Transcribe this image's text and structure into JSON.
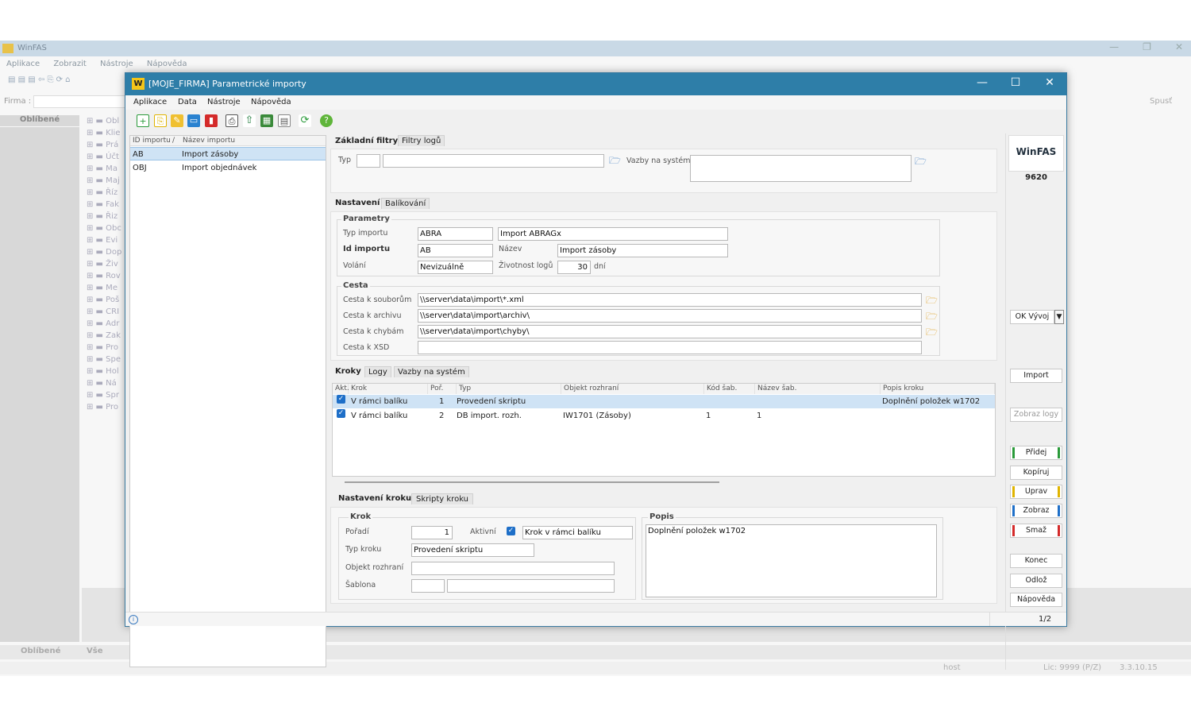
{
  "bg": {
    "title": "WinFAS",
    "menu": [
      "Aplikace",
      "Zobrazit",
      "Nástroje",
      "Nápověda"
    ],
    "firma_label": "Firma :",
    "tab_favorites": "Oblíbené",
    "bottom_tab1": "Oblíbené",
    "bottom_tab2": "Vše",
    "spust": "Spusť",
    "status_user": "host",
    "status_lic": "Lic: 9999 (P/Z)",
    "status_version": "3.3.10.15",
    "tree": [
      "Obl",
      "Klie",
      "Prá",
      "Účt",
      "Ma",
      "Maj",
      "Říz",
      "Fak",
      "Řiz",
      "Obc",
      "Evi",
      "Dop",
      "Živ",
      "Rov",
      "Me",
      "Poš",
      "CRI",
      "Adr",
      "Zak",
      "Pro",
      "Spe",
      "Hol",
      "Ná",
      "Spr",
      "Pro"
    ]
  },
  "dialog": {
    "title": "[MOJE_FIRMA] Parametrické importy",
    "menu": [
      "Aplikace",
      "Data",
      "Nástroje",
      "Nápověda"
    ],
    "toolbar_icons": [
      "add-icon",
      "copy-icon",
      "edit-icon",
      "view-icon",
      "delete-icon",
      "print-icon",
      "export-icon",
      "grid-icon",
      "report-icon",
      "refresh-icon",
      "help-icon"
    ]
  },
  "list": {
    "col_id": "ID importu",
    "col_sort": "/",
    "col_name": "Název importu",
    "rows": [
      {
        "id": "AB",
        "name": "Import zásoby"
      },
      {
        "id": "OBJ",
        "name": "Import objednávek"
      }
    ]
  },
  "filters": {
    "tab_basic": "Základní filtry",
    "tab_logs": "Filtry logů",
    "typ_label": "Typ",
    "vazby_label": "Vazby na systém"
  },
  "settings": {
    "tab_settings": "Nastavení",
    "tab_packaging": "Balíkování",
    "params_legend": "Parametry",
    "typ_importu_label": "Typ importu",
    "typ_importu_code": "ABRA",
    "typ_importu_name": "Import ABRAGx",
    "id_importu_label": "Id importu",
    "id_importu_value": "AB",
    "nazev_label": "Název",
    "nazev_value": "Import zásoby",
    "volani_label": "Volání",
    "volani_value": "Nevizuálně",
    "zivotnost_label": "Životnost logů",
    "zivotnost_value": "30",
    "zivotnost_unit": "dní",
    "cesta_legend": "Cesta",
    "cesta_soubory_label": "Cesta k souborům",
    "cesta_soubory_value": "\\\\server\\data\\import\\*.xml",
    "cesta_archiv_label": "Cesta k archivu",
    "cesta_archiv_value": "\\\\server\\data\\import\\archiv\\",
    "cesta_chyby_label": "Cesta k chybám",
    "cesta_chyby_value": "\\\\server\\data\\import\\chyby\\",
    "cesta_xsd_label": "Cesta k XSD",
    "cesta_xsd_value": ""
  },
  "steps": {
    "tab_kroky": "Kroky",
    "tab_logy": "Logy",
    "tab_vazby": "Vazby na systém",
    "columns": [
      "Akt.",
      "Krok",
      "Poř.",
      "Typ",
      "Objekt rozhraní",
      "Kód šab.",
      "Název šab.",
      "Popis kroku"
    ],
    "rows": [
      {
        "krok": "V rámci balíku",
        "por": "1",
        "typ": "Provedení skriptu",
        "objekt": "",
        "kod": "",
        "nazev": "",
        "popis": "Doplnění položek w1702"
      },
      {
        "krok": "V rámci balíku",
        "por": "2",
        "typ": "DB import. rozh.",
        "objekt": "IW1701 (Zásoby)",
        "kod": "1",
        "nazev": "1",
        "popis": ""
      }
    ]
  },
  "step_detail": {
    "tab_settings": "Nastavení kroku",
    "tab_scripts": "Skripty kroku",
    "krok_legend": "Krok",
    "poradi_label": "Pořadí",
    "poradi_value": "1",
    "aktivni_label": "Aktivní",
    "krok_value": "Krok v rámci balíku",
    "typ_kroku_label": "Typ kroku",
    "typ_kroku_value": "Provedení skriptu",
    "objekt_label": "Objekt rozhraní",
    "objekt_value": "",
    "sablona_label": "Šablona",
    "popis_legend": "Popis",
    "popis_value": "Doplnění položek w1702"
  },
  "side": {
    "brand": "WinFAS",
    "number": "9620",
    "ok_vyvoj": "OK Vývoj",
    "import": "Import",
    "zobraz_logy": "Zobraz logy",
    "pridej": "Přidej",
    "kopiruj": "Kopíruj",
    "uprav": "Uprav",
    "zobraz": "Zobraz",
    "smaz": "Smaž",
    "konec": "Konec",
    "odloz": "Odlož",
    "napoveda": "Nápověda"
  },
  "statusbar": {
    "page": "1/2"
  },
  "colors": {
    "titlebar": "#2e7ea8",
    "selection": "#cfe3f5",
    "add": "#2a9a3a",
    "edit": "#e0b400",
    "view": "#1e6fc8",
    "delete": "#d42a2a"
  }
}
